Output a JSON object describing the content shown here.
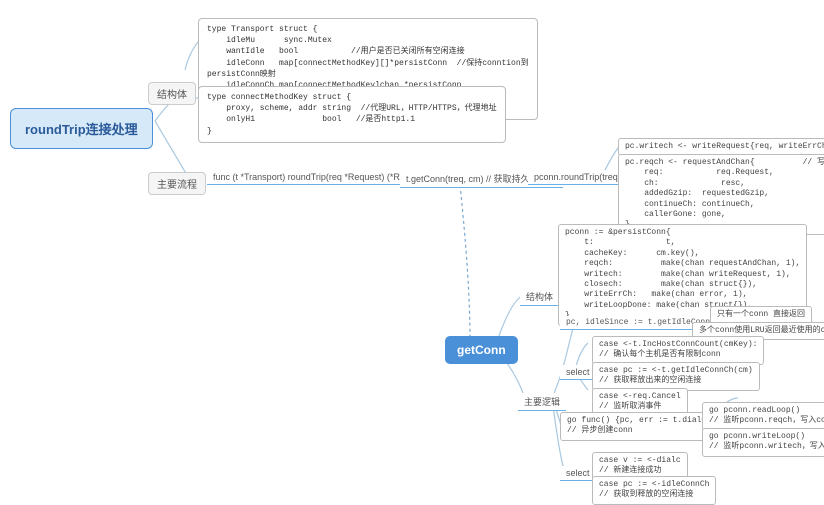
{
  "root": "roundTrip连接处理",
  "branches": {
    "struct": "结构体",
    "flow": "主要流程"
  },
  "structCode1": "type Transport struct {\n    idleMu      sync.Mutex\n    wantIdle   bool           //用户是否已关闭所有空闲连接\n    idleConn   map[connectMethodKey][]*persistConn  //保持conntion到\npersistConn映射\n    idleConnCh map[connectMethodKey]chan *persistConn\n    idleLRU    connLRU\n}",
  "structCode2": "type connectMethodKey struct {\n    proxy, scheme, addr string  //代理URL，HTTP/HTTPS，代理地址\n    onlyH1              bool   //是否http1.1\n}",
  "flow": {
    "n1": "func (t *Transport) roundTrip(req *Request) (*Response, error)",
    "n2": "t.getConn(treq, cm)  // 获取持久化连接",
    "n3": "pconn.roundTrip(treq)"
  },
  "rt": {
    "l1": "pc.writech <- writeRequest{req, writeErrCh, continueCh}",
    "l2": "pc.reqch <- requestAndChan{          // 写pc.reqch\n    req:           req.Request,\n    ch:             resc,\n    addedGzip:  requestedGzip,\n    continueCh: continueCh,\n    callerGone: gone,\n}"
  },
  "getConn": {
    "label": "getConn",
    "structLabel": "结构体",
    "logicLabel": "主要逻辑",
    "pconn": "pconn := &persistConn{\n    t:               t,\n    cacheKey:      cm.key(),\n    reqch:          make(chan requestAndChan, 1),\n    writech:        make(chan writeRequest, 1),\n    closech:        make(chan struct{}),\n    writeErrCh:   make(chan error, 1),\n    writeLoopDone: make(chan struct{}),\n}",
    "idle": "pc, idleSince := t.getIdleConn(cm)",
    "idle1": "只有一个conn 直接返回",
    "idle2": "多个conn使用LRU返回最近使用的conn",
    "selectLabel": "select",
    "s1": "case <-t.IncHostConnCount(cmKey):\n// 确认每个主机是否有限制conn",
    "s2": "case pc := <-t.getIdleConnCh(cm)\n// 获取释放出来的空闲连接",
    "s3": "case <-req.Cancel\n// 监听取消事件",
    "dial": "go func() {pc, err := t.dialConn(ctx, cm)}\n// 异步创建conn",
    "dial1": "go pconn.readLoop()\n// 监听pconn.reqch，写入conn结构体",
    "dial2": "go pconn.writeLoop()\n// 监听pconn.writech，写入conn结构体",
    "sel2": "select",
    "s4": "case v := <-dialc\n// 新建连接成功",
    "s5": "case pc := <-idleConnCh\n// 获取到释放的空闲连接"
  }
}
